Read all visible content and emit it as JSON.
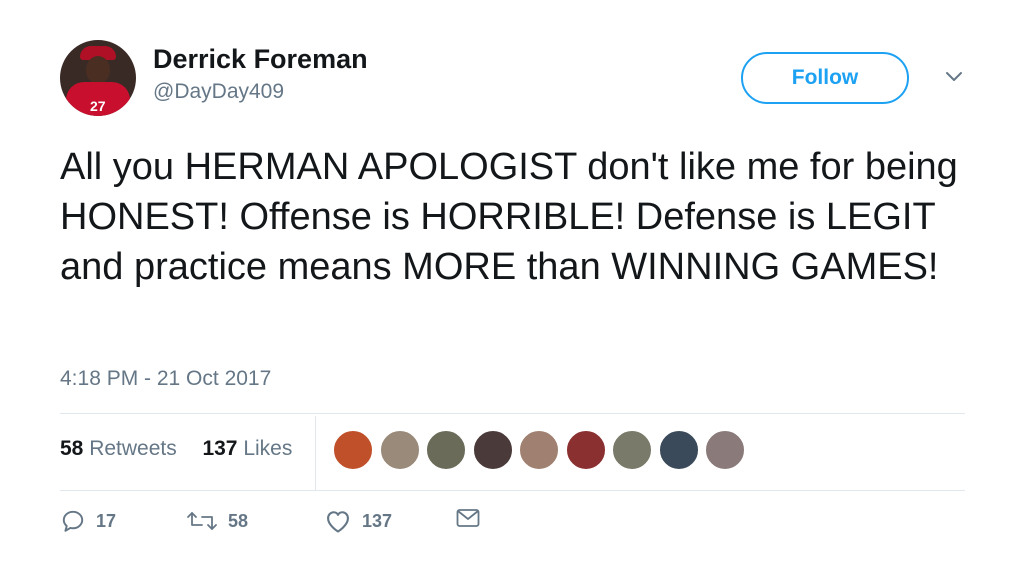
{
  "user": {
    "name": "Derrick Foreman",
    "handle": "@DayDay409",
    "avatar_jersey_number": "27"
  },
  "header": {
    "follow_label": "Follow",
    "menu_icon": "chevron-down-icon"
  },
  "tweet": {
    "text": "All you HERMAN APOLOGIST don't like me for being HONEST! Offense is HORRIBLE! Defense is LEGIT and practice means MORE than WINNING GAMES!",
    "timestamp": "4:18 PM - 21 Oct 2017"
  },
  "stats": {
    "retweets_count": "58",
    "retweets_label": "Retweets",
    "likes_count": "137",
    "likes_label": "Likes"
  },
  "likers": [
    {
      "color": "#c0502a"
    },
    {
      "color": "#9a8a7a"
    },
    {
      "color": "#6b6b5a"
    },
    {
      "color": "#4a3a3a"
    },
    {
      "color": "#a08070"
    },
    {
      "color": "#8a3030"
    },
    {
      "color": "#7a7a6a"
    },
    {
      "color": "#3a4a5a"
    },
    {
      "color": "#8a7a7a"
    }
  ],
  "actions": {
    "reply_count": "17",
    "retweet_count": "58",
    "like_count": "137"
  },
  "colors": {
    "accent": "#1da1f2",
    "text": "#14171a",
    "secondary": "#657786",
    "border": "#e1e8ed"
  }
}
